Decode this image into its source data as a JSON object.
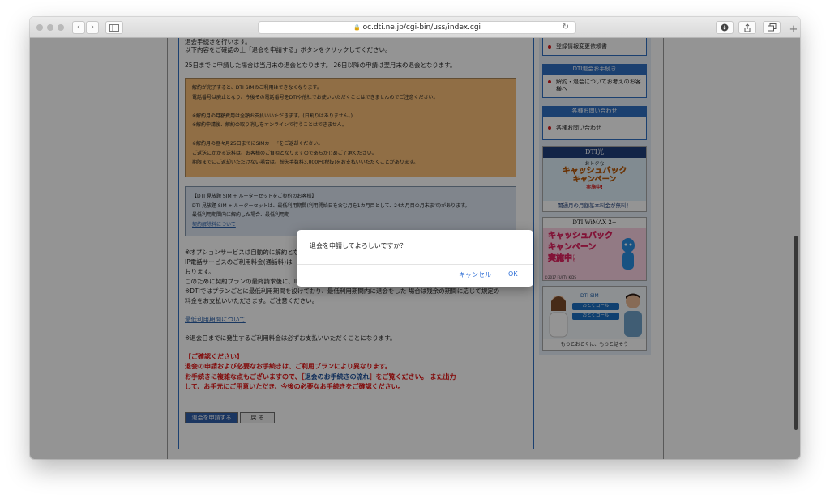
{
  "browser": {
    "url": "oc.dti.ne.jp/cgi-bin/uss/index.cgi",
    "nav_back": "‹",
    "nav_forward": "›",
    "new_tab": "+"
  },
  "main": {
    "intro_line1": "退会手続きを行います。",
    "intro_line2": "以下内容をご確認の上「退会を申請する」ボタンをクリックしてください。",
    "deadline_line": "25日までに申請した場合は当月末の退会となります。 26日以降の申請は翌月末の退会となります。",
    "orange_notice": [
      "解約が完了すると、DTI SIMのご利用はできなくなります。",
      "電話番号は廃止となり、今後その電話番号をDTIや他社でお使いいただくことはできませんのでご注意ください。",
      "",
      "※解約月の月額費用は全額お支払いいただきます。(日割りはありません。)",
      "※解約申請後、解約の取り消しをオンラインで行うことはできません。",
      "",
      "※解約月の翌々月25日までにSIMカードをご返却ください。",
      "ご返送にかかる送料は、お客様のご負担となりますのであらかじめご了承ください。",
      "期限までにご返却いただけない場合は、紛失手数料3,000円(税抜)をお支払いいただくことがあります。"
    ],
    "blue_notice": [
      "【DTI 見放題 SIM + ルーターセットをご契約のお客様】",
      "DTI 見放題 SIM + ルーターセットは、最低利用期間(利用開始日を含む月を1カ月目として、24カ月目の月末まで)があります。",
      "最低利用期間内に解約した場合、最低利用期"
    ],
    "blue_link": "契約解除料について",
    "option_lines": [
      "※オプションサービスは自動的に解約とな",
      "IP電話サービスのご利用料金(通話料)は",
      "おります。",
      "このために契約プランの最終請求後に、IP電話サービス利用料金をご請求させて いただく場合があります。",
      "※DTIではプランごとに最低利用期間を設けており、最低利用期間内に退会をした 場合は残余の期間に応じて規定の",
      "料金をお支払いいただきます。ご注意ください。"
    ],
    "min_period_link": "最低利用期間について",
    "fee_note": "※退会日までに発生するご利用料金は必ずお支払いいただくことになります。",
    "confirm_title": "【ご確認ください】",
    "confirm_line1": "退会の申請および必要なお手続きは、ご利用プランにより異なります。",
    "confirm_line2_a": "お手続きに複雑な点もございますので、［",
    "confirm_line2_link": "退会のお手続きの流れ",
    "confirm_line2_b": "］をご覧ください。 また出力",
    "confirm_line3": "して、お手元にご用意いただき、今後の必要なお手続きをご確認ください。",
    "apply_button": "退会を申請する",
    "back_button": "戻 る"
  },
  "sidebar": {
    "top_link": "登録情報変更依頼書",
    "section1_header": "DTI退会お手続き",
    "section1_link": "解約・退会についてお考えのお客様へ",
    "section2_header": "各種お問い合わせ",
    "section2_link": "各種お問い合わせ",
    "banner1_logo": "DTI光",
    "banner1_sub": "おトクな",
    "banner1_main1": "キャッシュバック",
    "banner1_main2": "キャンペーン",
    "banner1_badge": "実施中!",
    "banner1_foot": "開通月の月額基本料金が無料！",
    "banner2_logo": "DTI WiMAX 2+",
    "banner2_main1": "キャッシュバック",
    "banner2_main2": "キャンペーン",
    "banner2_main3": "実施中!",
    "banner2_copy": "©2017 FUJITV KIDS",
    "banner3_logo": "DTI SIM",
    "banner3_btn1": "おとくコール",
    "banner3_btn2": "おとくコール",
    "banner3_foot": "もっとおとくに、もっと話そう"
  },
  "dialog": {
    "message": "退会を申請してよろしいですか？",
    "cancel": "キャンセル",
    "ok": "OK"
  },
  "colors": {
    "accent": "#2f6fd6",
    "red_text": "#e01010",
    "orange_box": "#f8be77",
    "blue_box": "#dce6f2"
  }
}
